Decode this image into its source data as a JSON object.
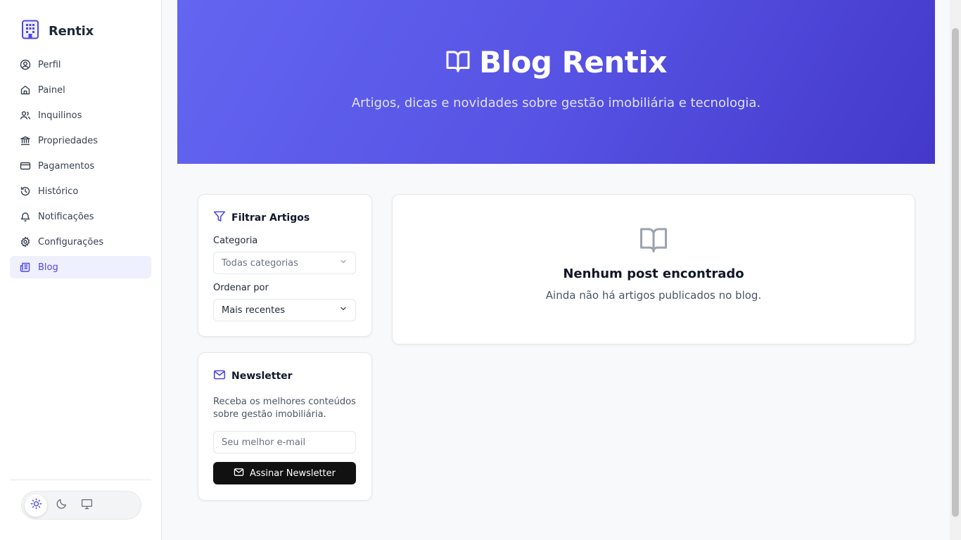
{
  "sidebar": {
    "brand": "Rentix",
    "items": [
      {
        "label": "Perfil",
        "icon": "user-circle-icon"
      },
      {
        "label": "Painel",
        "icon": "home-icon"
      },
      {
        "label": "Inquilinos",
        "icon": "users-icon"
      },
      {
        "label": "Propriedades",
        "icon": "bank-icon"
      },
      {
        "label": "Pagamentos",
        "icon": "credit-card-icon"
      },
      {
        "label": "Histórico",
        "icon": "history-icon"
      },
      {
        "label": "Notificações",
        "icon": "bell-icon"
      },
      {
        "label": "Configurações",
        "icon": "gear-icon"
      },
      {
        "label": "Blog",
        "icon": "newspaper-icon",
        "active": true
      }
    ],
    "theme_options": [
      "light",
      "dark",
      "system"
    ],
    "theme_selected": "light"
  },
  "hero": {
    "title": "Blog Rentix",
    "subtitle": "Artigos, dicas e novidades sobre gestão imobiliária e tecnologia."
  },
  "filter": {
    "title": "Filtrar Artigos",
    "category_label": "Categoria",
    "category_value": "Todas categorias",
    "order_label": "Ordenar por",
    "order_value": "Mais recentes"
  },
  "newsletter": {
    "title": "Newsletter",
    "description": "Receba os melhores conteúdos sobre gestão imobiliária.",
    "email_placeholder": "Seu melhor e-mail",
    "button": "Assinar Newsletter"
  },
  "empty": {
    "title": "Nenhum post encontrado",
    "subtitle": "Ainda não há artigos publicados no blog."
  },
  "colors": {
    "accent": "#4f46e5",
    "hero_start": "#6366f1",
    "hero_end": "#4338ca",
    "button_dark": "#111111"
  }
}
